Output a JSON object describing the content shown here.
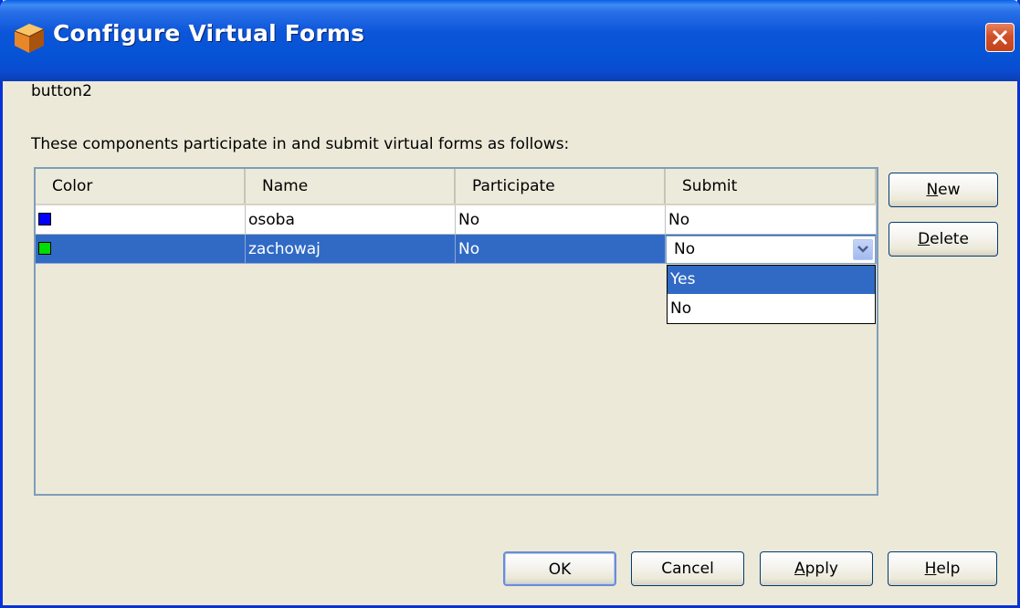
{
  "window": {
    "title": "Configure Virtual Forms",
    "close_label": "X"
  },
  "component_name": "button2",
  "description": "These components participate in and submit virtual forms as follows:",
  "table": {
    "columns": [
      "Color",
      "Name",
      "Participate",
      "Submit"
    ],
    "rows": [
      {
        "color": "#0000ff",
        "name": "osoba",
        "participate": "No",
        "submit": "No",
        "selected": false
      },
      {
        "color": "#00dd00",
        "name": "zachowaj",
        "participate": "No",
        "submit": "No",
        "selected": true
      }
    ]
  },
  "submit_combo": {
    "value": "No",
    "options": [
      "Yes",
      "No"
    ],
    "highlighted_option": "Yes"
  },
  "side_buttons": {
    "new": {
      "pre": "",
      "mnemonic": "N",
      "post": "ew"
    },
    "delete": {
      "pre": "",
      "mnemonic": "D",
      "post": "elete"
    }
  },
  "footer_buttons": {
    "ok": "OK",
    "cancel": "Cancel",
    "apply": {
      "pre": "",
      "mnemonic": "A",
      "post": "pply"
    },
    "help": {
      "pre": "",
      "mnemonic": "H",
      "post": "elp"
    }
  },
  "colors": {
    "titlebar": "#0653d5",
    "selection": "#316ac5",
    "dialog_bg": "#ece9d8"
  }
}
